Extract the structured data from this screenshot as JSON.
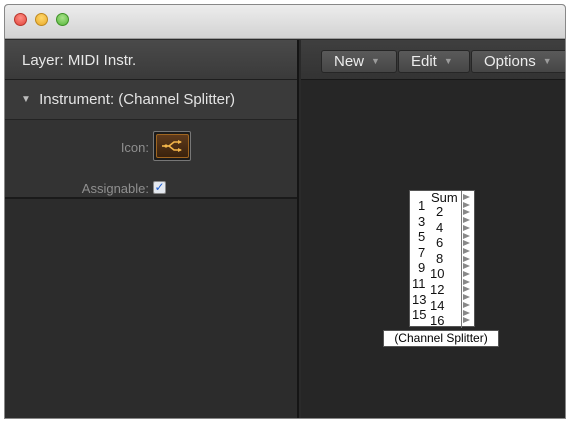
{
  "window": {
    "traffic_lights": [
      {
        "name": "close",
        "color": "#e0443a"
      },
      {
        "name": "minimize",
        "color": "#e9a92b"
      },
      {
        "name": "zoom",
        "color": "#55b63a"
      }
    ]
  },
  "inspector": {
    "layer_label": "Layer:  MIDI Instr.",
    "section_title": "Instrument: (Channel Splitter)",
    "icon_label": "Icon:",
    "icon_name": "midi-splitter-icon",
    "assignable_label": "Assignable:",
    "assignable_checked": true
  },
  "toolbar": {
    "new_label": "New",
    "edit_label": "Edit",
    "options_label": "Options"
  },
  "environment_object": {
    "name": "(Channel Splitter)",
    "sum_label": "Sum",
    "odd_channels": [
      "1",
      "3",
      "5",
      "7",
      "9",
      "11",
      "13",
      "15"
    ],
    "even_channels": [
      "2",
      "4",
      "6",
      "8",
      "10",
      "12",
      "14",
      "16"
    ],
    "output_count": 17
  }
}
